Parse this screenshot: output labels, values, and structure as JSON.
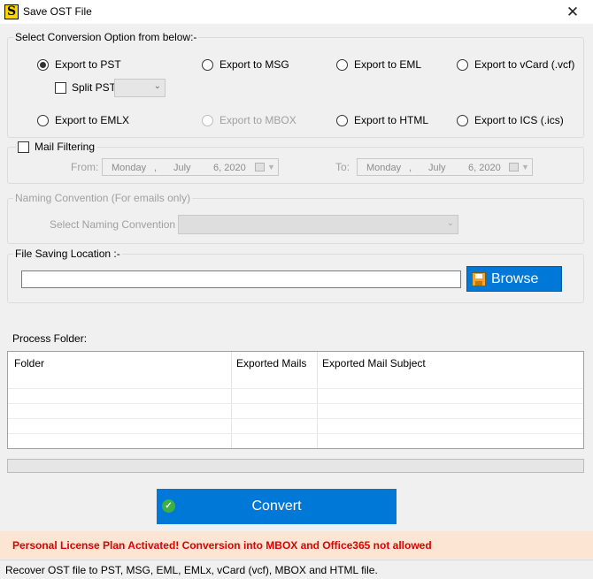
{
  "window": {
    "title": "Save OST File",
    "icon_letter": "S",
    "close_glyph": "✕"
  },
  "conversion": {
    "legend": "Select Conversion Option from below:-",
    "options": [
      {
        "label": "Export to PST",
        "checked": true,
        "disabled": false
      },
      {
        "label": "Export to MSG",
        "checked": false,
        "disabled": false
      },
      {
        "label": "Export to EML",
        "checked": false,
        "disabled": false
      },
      {
        "label": "Export to vCard (.vcf)",
        "checked": false,
        "disabled": false
      },
      {
        "label": "Export to EMLX",
        "checked": false,
        "disabled": false
      },
      {
        "label": "Export to MBOX",
        "checked": false,
        "disabled": true
      },
      {
        "label": "Export to HTML",
        "checked": false,
        "disabled": false
      },
      {
        "label": "Export to ICS (.ics)",
        "checked": false,
        "disabled": false
      }
    ],
    "split_pst_label": "Split PST",
    "split_pst_value": ""
  },
  "mail_filtering": {
    "label": "Mail Filtering",
    "from_label": "From:",
    "to_label": "To:",
    "from": {
      "day": "Monday",
      "sep": ",",
      "month": "July",
      "date": "6, 2020"
    },
    "to": {
      "day": "Monday",
      "sep": ",",
      "month": "July",
      "date": "6, 2020"
    }
  },
  "naming": {
    "legend": "Naming Convention (For emails only)",
    "select_label": "Select Naming Convention :",
    "select_value": ""
  },
  "saving": {
    "legend": "File Saving Location :-",
    "path_value": "",
    "browse_label": "Browse"
  },
  "process": {
    "label": "Process Folder:",
    "columns": [
      "Folder",
      "Exported Mails",
      "Exported Mail Subject"
    ],
    "rows": []
  },
  "progress": 0,
  "convert_label": "Convert",
  "license_message": "Personal License Plan Activated! Conversion into MBOX and Office365 not allowed",
  "status_text": "Recover OST file to PST, MSG, EML, EMLx, vCard (vcf), MBOX and HTML file."
}
